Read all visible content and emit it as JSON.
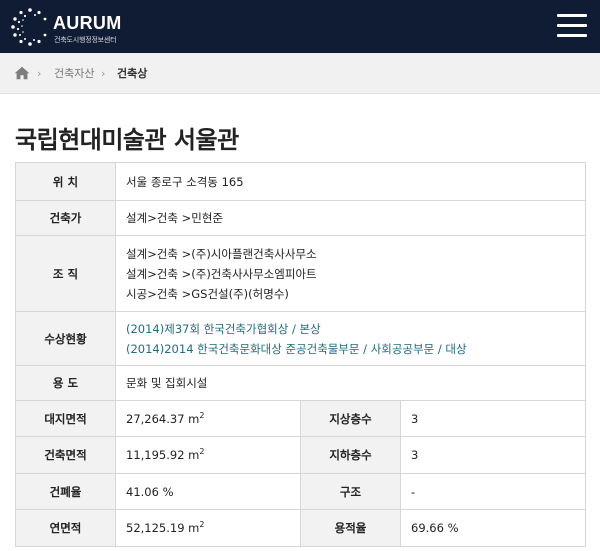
{
  "header": {
    "logo_title": "AURUM",
    "logo_subtitle": "건축도시행정정보센터",
    "menu_icon": "hamburger-menu-icon"
  },
  "breadcrumb": {
    "home_icon": "home-icon",
    "items": [
      "건축자산",
      "건축상"
    ]
  },
  "page": {
    "title": "국립현대미술관 서울관"
  },
  "details": {
    "location": {
      "label": "위 치",
      "value": "서울 종로구 소격동 165"
    },
    "architect": {
      "label": "건축가",
      "value": "설계>건축 >민현준"
    },
    "organization": {
      "label": "조 직",
      "lines": [
        "설계>건축 >(주)시아플랜건축사사무소",
        "설계>건축 >(주)건축사사무소엠피아트",
        "시공>건축 >GS건설(주)(허명수)"
      ]
    },
    "awards": {
      "label": "수상현황",
      "lines": [
        "(2014)제37회 한국건축가협회상 / 본상",
        "(2014)2014 한국건축문화대상 준공건축물부문 / 사회공공부문 / 대상"
      ],
      "color": "#1f6d7d"
    },
    "usage": {
      "label": "용 도",
      "value": "문화 및 집회시설"
    },
    "site_area": {
      "label": "대지면적",
      "value": "27,264.37 m",
      "unit_sup": "2"
    },
    "floors_above": {
      "label": "지상층수",
      "value": "3"
    },
    "building_area": {
      "label": "건축면적",
      "value": "11,195.92 m",
      "unit_sup": "2"
    },
    "floors_below": {
      "label": "지하층수",
      "value": "3"
    },
    "coverage_ratio": {
      "label": "건폐율",
      "value": "41.06 %"
    },
    "structure": {
      "label": "구조",
      "value": "-"
    },
    "total_floor_area": {
      "label": "연면적",
      "value": "52,125.19 m",
      "unit_sup": "2"
    },
    "floor_area_ratio": {
      "label": "용적율",
      "value": "69.66 %"
    }
  }
}
